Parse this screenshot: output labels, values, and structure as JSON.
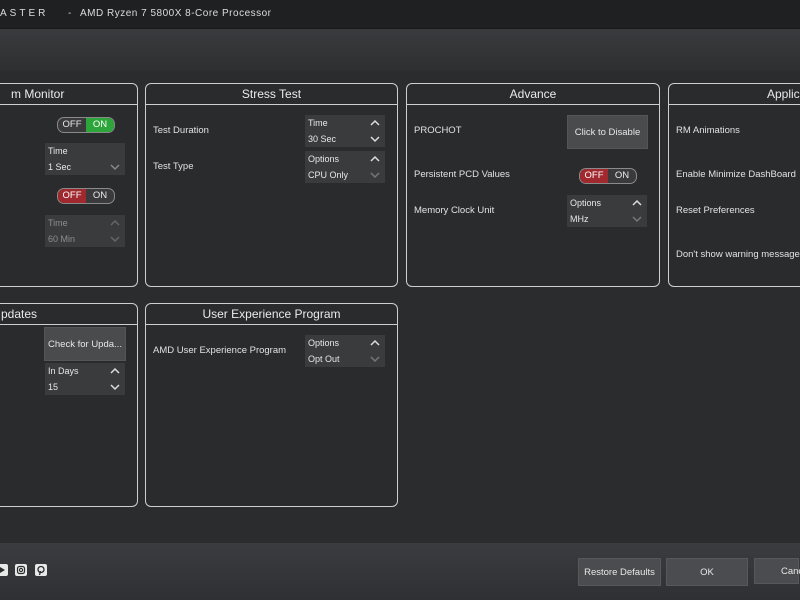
{
  "titlebar": {
    "app_name": "ASTER",
    "separator": "-",
    "cpu": "AMD Ryzen 7 5800X 8-Core Processor"
  },
  "panels": {
    "system_monitor": {
      "title": "m Monitor",
      "toggle1": {
        "off": "OFF",
        "on": "ON",
        "state": "on"
      },
      "dd1": {
        "label": "Time",
        "value": "1 Sec"
      },
      "toggle2": {
        "off": "OFF",
        "on": "ON",
        "state": "off"
      },
      "dd2": {
        "label": "Time",
        "value": "60 Min"
      }
    },
    "stress_test": {
      "title": "Stress Test",
      "test_duration_label": "Test Duration",
      "duration_dd": {
        "label": "Time",
        "value": "30 Sec"
      },
      "test_type_label": "Test Type",
      "type_dd": {
        "label": "Options",
        "value": "CPU Only"
      }
    },
    "advance": {
      "title": "Advance",
      "prochot_label": "PROCHOT",
      "prochot_button": "Click to Disable",
      "pcd_label": "Persistent PCD Values",
      "pcd_toggle": {
        "off": "OFF",
        "on": "ON",
        "state": "off"
      },
      "mem_label": "Memory Clock Unit",
      "mem_dd": {
        "label": "Options",
        "value": "MHz"
      }
    },
    "application": {
      "title": "Applica",
      "rm_animations": "RM Animations",
      "minimize_dashboard": "Enable Minimize DashBoard",
      "reset_preferences": "Reset Preferences",
      "dont_show_warning": "Don't show warning message"
    },
    "updates": {
      "title": "pdates",
      "check_button": "Check for Upda...",
      "dd": {
        "label": "In Days",
        "value": "15"
      }
    },
    "uxp": {
      "title": "User Experience Program",
      "label": "AMD User Experience Program",
      "dd": {
        "label": "Options",
        "value": "Opt Out"
      }
    }
  },
  "bottom": {
    "social_icons": [
      "youtube-icon",
      "instagram-icon",
      "pinterest-icon"
    ],
    "restore_defaults": "Restore Defaults",
    "ok": "OK",
    "cancel": "Canc"
  },
  "colors": {
    "on_green": "#2ca63a",
    "off_red": "#a0282f",
    "background": "#2b2c2e"
  }
}
